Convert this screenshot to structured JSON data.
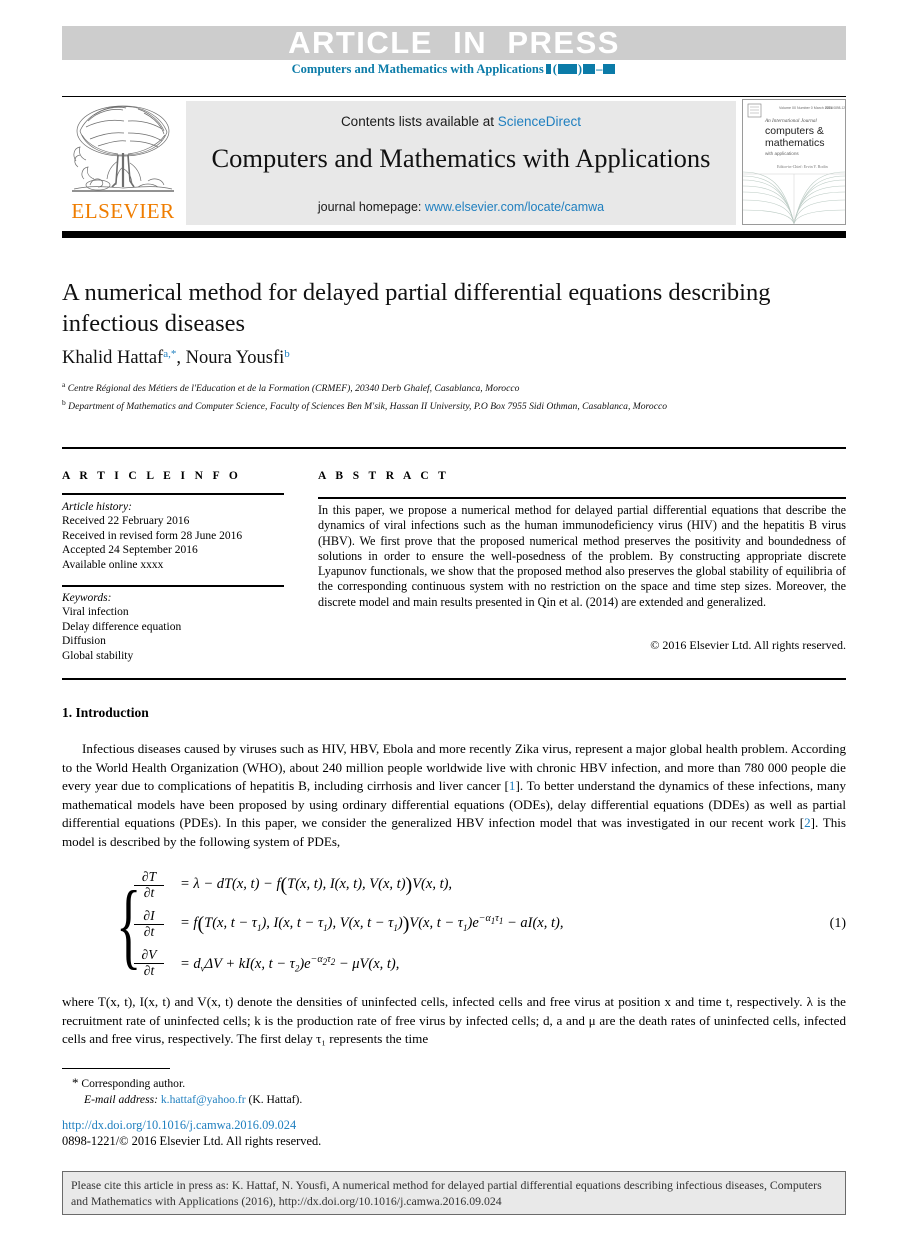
{
  "banner": {
    "article_in_press": "ARTICLE  IN  PRESS",
    "journal_ref_prefix": "Computers and Mathematics with Applications",
    "journal_ref_suffix_open": "(",
    "journal_ref_suffix_close": ")",
    "journal_ref_dash": "–"
  },
  "masthead": {
    "contents_prefix": "Contents lists available at ",
    "contents_link": "ScienceDirect",
    "journal_title": "Computers and Mathematics with Applications",
    "homepage_prefix": "journal homepage: ",
    "homepage_link": "www.elsevier.com/locate/camwa",
    "publisher_wordmark": "ELSEVIER",
    "cover_line1": "An International Journal",
    "cover_line2": "computers &",
    "cover_line3": "mathematics",
    "cover_line4": "with applications",
    "cover_line5": "Editor-in-Chief:  Ervin Y. Rodin"
  },
  "article": {
    "title": "A numerical method for delayed partial differential equations describing infectious diseases",
    "author1_name": "Khalid Hattaf",
    "author1_marks": "a,*",
    "author_sep": ", ",
    "author2_name": "Noura Yousfi",
    "author2_marks": "b",
    "affiliation_a_mark": "a",
    "affiliation_a": "Centre Régional des Métiers de l'Education et de la Formation (CRMEF), 20340 Derb Ghalef, Casablanca, Morocco",
    "affiliation_b_mark": "b",
    "affiliation_b": "Department of Mathematics and Computer Science, Faculty of Sciences Ben M'sik, Hassan II University, P.O Box 7955 Sidi Othman, Casablanca, Morocco"
  },
  "article_info": {
    "heading": "A R T I C L E   I N F O",
    "history_label": "Article history:",
    "history": [
      "Received 22 February 2016",
      "Received in revised form 28 June 2016",
      "Accepted 24 September 2016",
      "Available online xxxx"
    ],
    "keywords_label": "Keywords:",
    "keywords": [
      "Viral infection",
      "Delay difference equation",
      "Diffusion",
      "Global stability"
    ]
  },
  "abstract": {
    "heading": "A B S T R A C T",
    "text": "In this paper, we propose a numerical method for delayed partial differential equations that describe the dynamics of viral infections such as the human immunodeficiency virus (HIV) and the hepatitis B virus (HBV). We first prove that the proposed numerical method preserves the positivity and boundedness of solutions in order to ensure the well-posedness of the problem. By constructing appropriate discrete Lyapunov functionals, we show that the proposed method also preserves the global stability of equilibria of the corresponding continuous system with no restriction on the space and time step sizes. Moreover, the discrete model and main results presented in Qin et al. (2014) are extended and generalized.",
    "copyright": "© 2016 Elsevier Ltd. All rights reserved."
  },
  "body": {
    "section_heading": "1. Introduction",
    "paragraph1_a": "Infectious diseases caused by viruses such as HIV, HBV, Ebola and more recently Zika virus, represent a major global health problem. According to the World Health Organization (WHO), about 240 million people worldwide live with chronic HBV infection, and more than 780 000 people die every year due to complications of hepatitis B, including cirrhosis and liver cancer [",
    "ref1": "1",
    "paragraph1_b": "]. To better understand the dynamics of these infections, many mathematical models have been proposed by using ordinary differential equations (ODEs), delay differential equations (DDEs) as well as partial differential equations (PDEs). In this paper, we consider the generalized HBV infection model that was investigated in our recent work [",
    "ref2": "2",
    "paragraph1_c": "]. This model is described by the following system of PDEs,",
    "paragraph2": "where T(x, t), I(x, t) and V(x, t) denote the densities of uninfected cells, infected cells and free virus at position x and time t, respectively. λ is the recruitment rate of uninfected cells; k is the production rate of free virus by infected cells; d, a and μ are the death rates of uninfected cells, infected cells and free virus, respectively. The first delay τ₁ represents the time"
  },
  "equation": {
    "number": "(1)",
    "row1_num": "∂T",
    "row1_den": "∂t",
    "row1_rhs_pre": "= λ − dT(x, t) − f",
    "row1_rhs_inner": "T(x, t), I(x, t), V(x, t)",
    "row1_rhs_post": "V(x, t),",
    "row2_num": "∂I",
    "row2_den": "∂t",
    "row2_rhs_pre": "= f",
    "row2_rhs_inner": "T(x, t − τ1), I(x, t − τ1), V(x, t − τ1)",
    "row2_rhs_post": "V(x, t − τ1)e−α1τ1 − aI(x, t),",
    "row3_num": "∂V",
    "row3_den": "∂t",
    "row3_rhs": "= dvΔV + kI(x, t − τ2)e−α2τ2 − μV(x, t),"
  },
  "footnotes": {
    "corresponding_star": "*",
    "corresponding_text": "Corresponding author.",
    "email_label": "E-mail address:",
    "email": "k.hattaf@yahoo.fr",
    "email_owner": "(K. Hattaf).",
    "doi": "http://dx.doi.org/10.1016/j.camwa.2016.09.024",
    "issn": "0898-1221/© 2016 Elsevier Ltd. All rights reserved."
  },
  "cite_box": {
    "text": "Please cite this article in press as: K. Hattaf, N. Yousfi, A numerical method for delayed partial differential equations describing infectious diseases, Computers and Mathematics with Applications (2016), http://dx.doi.org/10.1016/j.camwa.2016.09.024"
  },
  "colors": {
    "link": "#1f7fbf",
    "banner_bg": "#cdcdcd",
    "journal_ref": "#0b7ba8",
    "elsevier_orange": "#ef7d00",
    "masthead_bg": "#e8e8e8"
  }
}
